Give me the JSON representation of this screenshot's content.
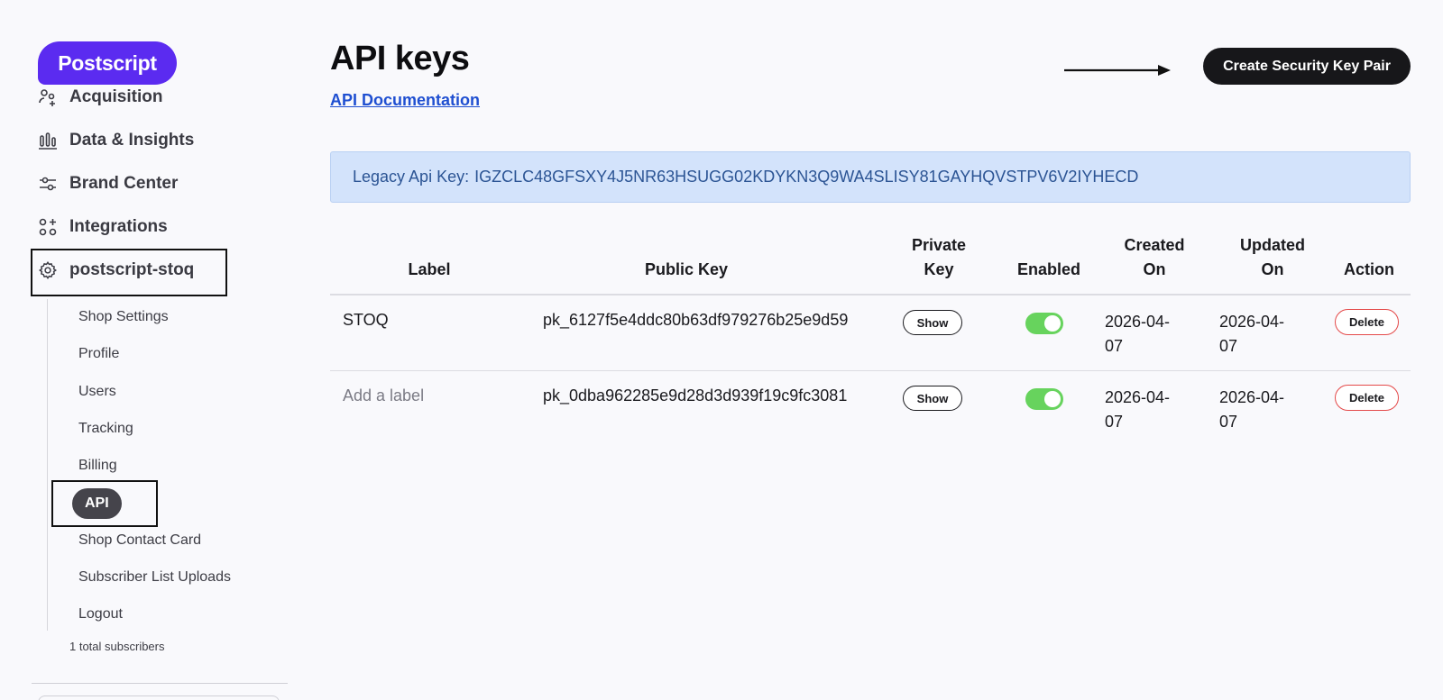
{
  "brand": {
    "logo_text": "Postscript",
    "accent": "#5b2bf0"
  },
  "sidebar": {
    "nav": [
      {
        "label": "Acquisition",
        "icon": "acquisition-icon"
      },
      {
        "label": "Data & Insights",
        "icon": "bar-chart-icon"
      },
      {
        "label": "Brand Center",
        "icon": "sliders-icon"
      },
      {
        "label": "Integrations",
        "icon": "integrations-icon"
      },
      {
        "label": "postscript-stoq",
        "icon": "gear-icon"
      }
    ],
    "sub_items": [
      "Shop Settings",
      "Profile",
      "Users",
      "Tracking",
      "Billing",
      "API",
      "Shop Contact Card",
      "Subscriber List Uploads",
      "Logout"
    ],
    "active_sub_item": "API",
    "subscriber_count": "1 total subscribers"
  },
  "main": {
    "title": "API keys",
    "doc_link": "API Documentation",
    "create_button": "Create Security Key Pair",
    "legacy_label": "Legacy Api Key:",
    "legacy_value": "IGZCLC48GFSXY4J5NR63HSUGG02KDYKN3Q9WA4SLISY81GAYHQVSTPV6V2IYHECD"
  },
  "table": {
    "headers": {
      "label": "Label",
      "public_key": "Public Key",
      "private_key_1": "Private",
      "private_key_2": "Key",
      "enabled": "Enabled",
      "created_1": "Created",
      "created_2": "On",
      "updated_1": "Updated",
      "updated_2": "On",
      "action": "Action"
    },
    "rows": [
      {
        "label": "STOQ",
        "public_key": "pk_6127f5e4ddc80b63df979276b25e9d59",
        "show": "Show",
        "enabled": true,
        "created_1": "2026-04-",
        "created_2": "07",
        "updated_1": "2026-04-",
        "updated_2": "07",
        "action": "Delete"
      },
      {
        "label": "Add a label",
        "public_key": "pk_0dba962285e9d28d3d939f19c9fc3081",
        "show": "Show",
        "enabled": true,
        "created_1": "2026-04-",
        "created_2": "07",
        "updated_1": "2026-04-",
        "updated_2": "07",
        "action": "Delete"
      }
    ]
  },
  "colors": {
    "toggle_on": "#67d35d",
    "delete_border": "#e44a4a",
    "legacy_bg": "#d3e3fb",
    "legacy_text": "#2b5494",
    "link": "#1f4fd1"
  }
}
